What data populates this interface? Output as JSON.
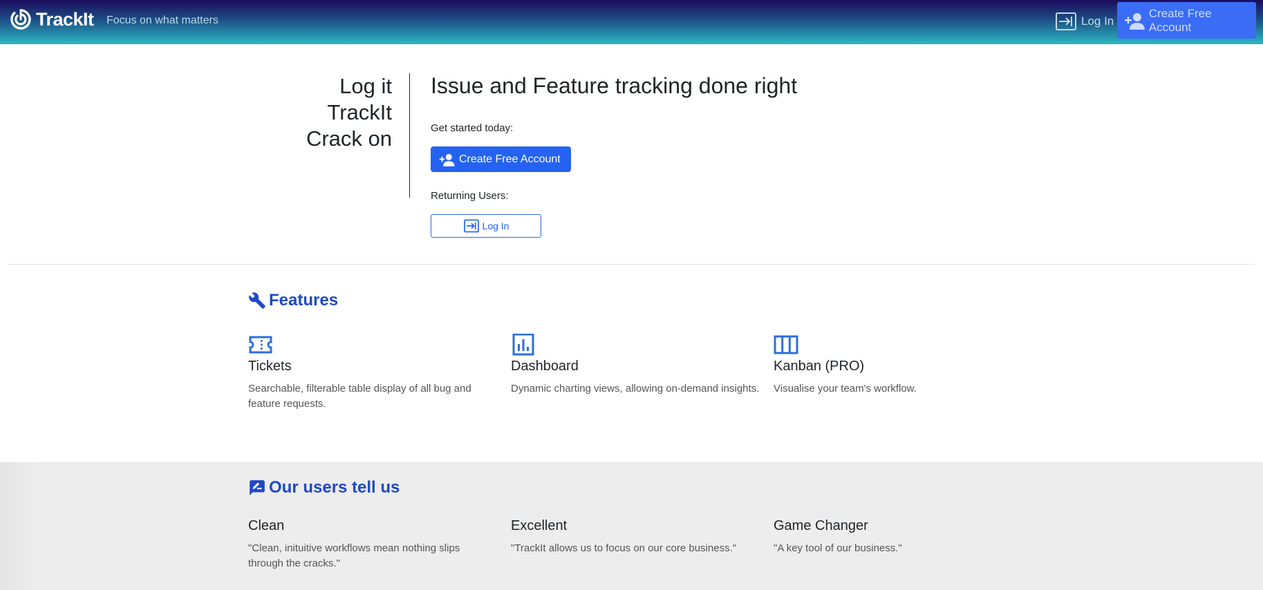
{
  "navbar": {
    "brand": "TrackIt",
    "tagline": "Focus on what matters",
    "login_label": "Log In",
    "create_label": "Create Free Account"
  },
  "hero": {
    "lines": [
      "Log it",
      "TrackIt",
      "Crack on"
    ],
    "title": "Issue and Feature tracking done right",
    "get_started": "Get started today:",
    "create_label": "Create Free Account",
    "returning": "Returning Users:",
    "login_label": "Log In"
  },
  "features": {
    "title": "Features",
    "items": [
      {
        "icon": "ticket-icon",
        "name": "Tickets",
        "desc": "Searchable, filterable table display of all bug and feature requests."
      },
      {
        "icon": "bar-chart-icon",
        "name": "Dashboard",
        "desc": "Dynamic charting views, allowing on-demand insights."
      },
      {
        "icon": "columns-icon",
        "name": "Kanban (PRO)",
        "desc": "Visualise your team's workflow."
      }
    ]
  },
  "testimonials": {
    "title": "Our users tell us",
    "items": [
      {
        "name": "Clean",
        "text": "\"Clean, inituitive workflows mean nothing slips through the cracks.\""
      },
      {
        "name": "Excellent",
        "text": "\"TrackIt allows us to focus on our core business.\""
      },
      {
        "name": "Game Changer",
        "text": "\"A key tool of our business.\""
      }
    ]
  },
  "colors": {
    "accent": "#2462f2",
    "section_title": "#1f49c9"
  }
}
